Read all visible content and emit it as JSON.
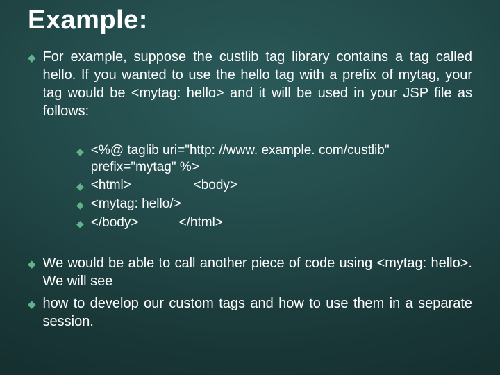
{
  "slide": {
    "title": "Example:",
    "bullets_top": [
      "For example, suppose the custlib tag library contains a tag called hello. If you wanted to use the hello tag with a prefix of mytag, your tag would be <mytag: hello> and it will be used in your JSP file as follows:"
    ],
    "code_lines": [
      "<%@ taglib uri=\"http: //www. example. com/custlib\" prefix=\"mytag\" %>",
      "<html>                 <body>",
      "<mytag: hello/>",
      "</body>           </html>"
    ],
    "bullets_bottom": [
      "We would be able to call another piece of code using <mytag: hello>. We will see",
      "how to develop our custom tags and how to use them in a separate session."
    ]
  }
}
